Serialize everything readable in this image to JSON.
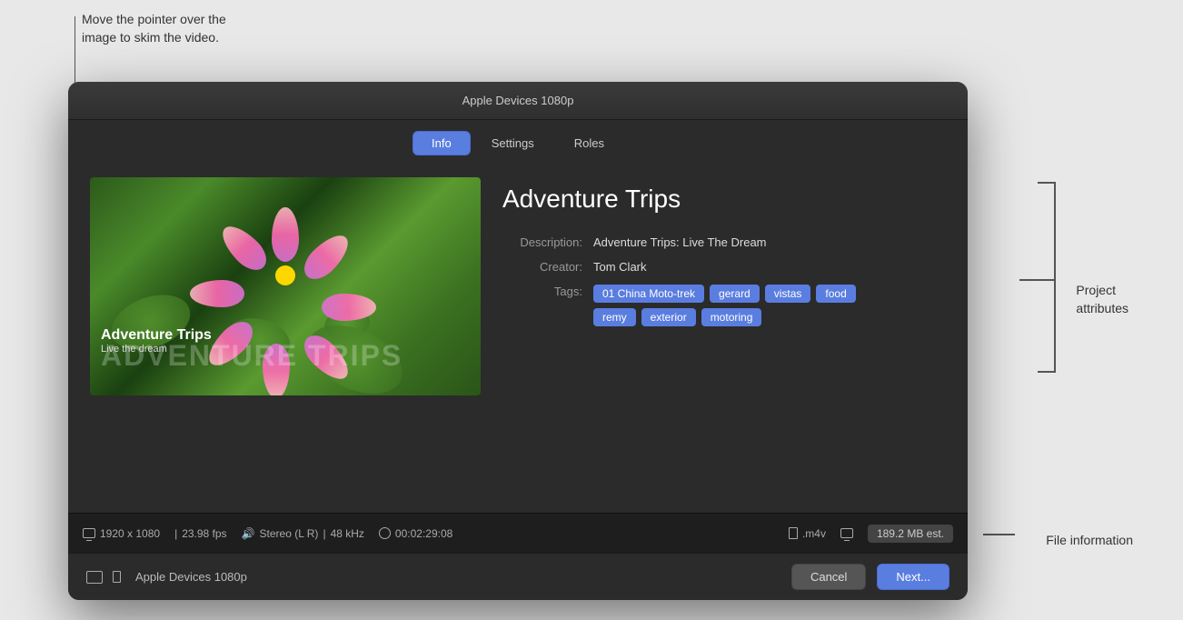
{
  "annotations": {
    "tooltip": "Move the pointer over the\nimage to skim the video.",
    "project_attributes": "Project\nattributes",
    "file_information": "File information"
  },
  "dialog": {
    "title": "Apple Devices 1080p",
    "tabs": [
      {
        "label": "Info",
        "active": true
      },
      {
        "label": "Settings",
        "active": false
      },
      {
        "label": "Roles",
        "active": false
      }
    ],
    "video": {
      "title": "Adventure Trips",
      "subtitle": "Live the dream",
      "watermark": "ADVENTURE TRIPS"
    },
    "info": {
      "project_title": "Adventure Trips",
      "description_label": "Description:",
      "description_value": "Adventure Trips: Live The Dream",
      "creator_label": "Creator:",
      "creator_value": "Tom Clark",
      "tags_label": "Tags:",
      "tags": [
        "01 China Moto-trek",
        "gerard",
        "vistas",
        "food",
        "remy",
        "exterior",
        "motoring"
      ]
    },
    "status_bar": {
      "resolution": "1920 x 1080",
      "fps": "23.98 fps",
      "audio": "Stereo (L R)",
      "sample_rate": "48 kHz",
      "duration": "00:02:29:08",
      "format": ".m4v",
      "file_size": "189.2 MB est."
    },
    "bottom_bar": {
      "device_label": "Apple Devices 1080p",
      "cancel_label": "Cancel",
      "next_label": "Next..."
    }
  }
}
